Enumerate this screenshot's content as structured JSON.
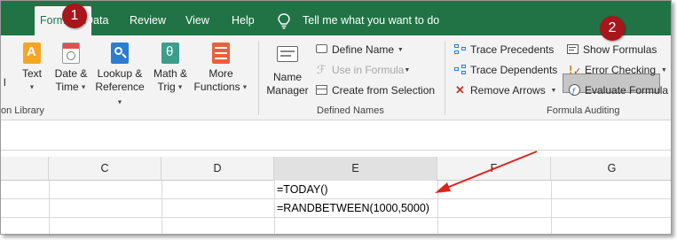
{
  "tabs": [
    {
      "label": "Formulas",
      "active": true
    },
    {
      "label": "Data",
      "active": false
    },
    {
      "label": "Review",
      "active": false
    },
    {
      "label": "View",
      "active": false
    },
    {
      "label": "Help",
      "active": false
    }
  ],
  "tell_me": "Tell me what you want to do",
  "markers": [
    "1",
    "2"
  ],
  "function_library": {
    "partial_first_label": "l",
    "buttons": [
      {
        "line1": "Text",
        "line2": "",
        "icon": "text-icon"
      },
      {
        "line1": "Date &",
        "line2": "Time",
        "icon": "date-time-icon"
      },
      {
        "line1": "Lookup &",
        "line2": "Reference",
        "icon": "lookup-reference-icon"
      },
      {
        "line1": "Math &",
        "line2": "Trig",
        "icon": "math-trig-icon"
      },
      {
        "line1": "More",
        "line2": "Functions",
        "icon": "more-functions-icon"
      }
    ],
    "group_label": "on Library"
  },
  "defined_names": {
    "name_manager_line1": "Name",
    "name_manager_line2": "Manager",
    "define_name": "Define Name",
    "use_in_formula": "Use in Formula",
    "create_from_selection": "Create from Selection",
    "group_label": "Defined Names"
  },
  "formula_auditing": {
    "trace_precedents": "Trace Precedents",
    "trace_dependents": "Trace Dependents",
    "remove_arrows": "Remove Arrows",
    "show_formulas": "Show Formulas",
    "error_checking": "Error Checking",
    "evaluate_formula": "Evaluate Formula",
    "group_label": "Formula Auditing"
  },
  "columns": [
    "C",
    "D",
    "E",
    "F",
    "G"
  ],
  "cells": {
    "e1": "=TODAY()",
    "e2": "=RANDBETWEEN(1000,5000)"
  },
  "colors": {
    "excel_green": "#217346",
    "marker_red": "#a7161a",
    "arrow_red": "#e0221c"
  }
}
